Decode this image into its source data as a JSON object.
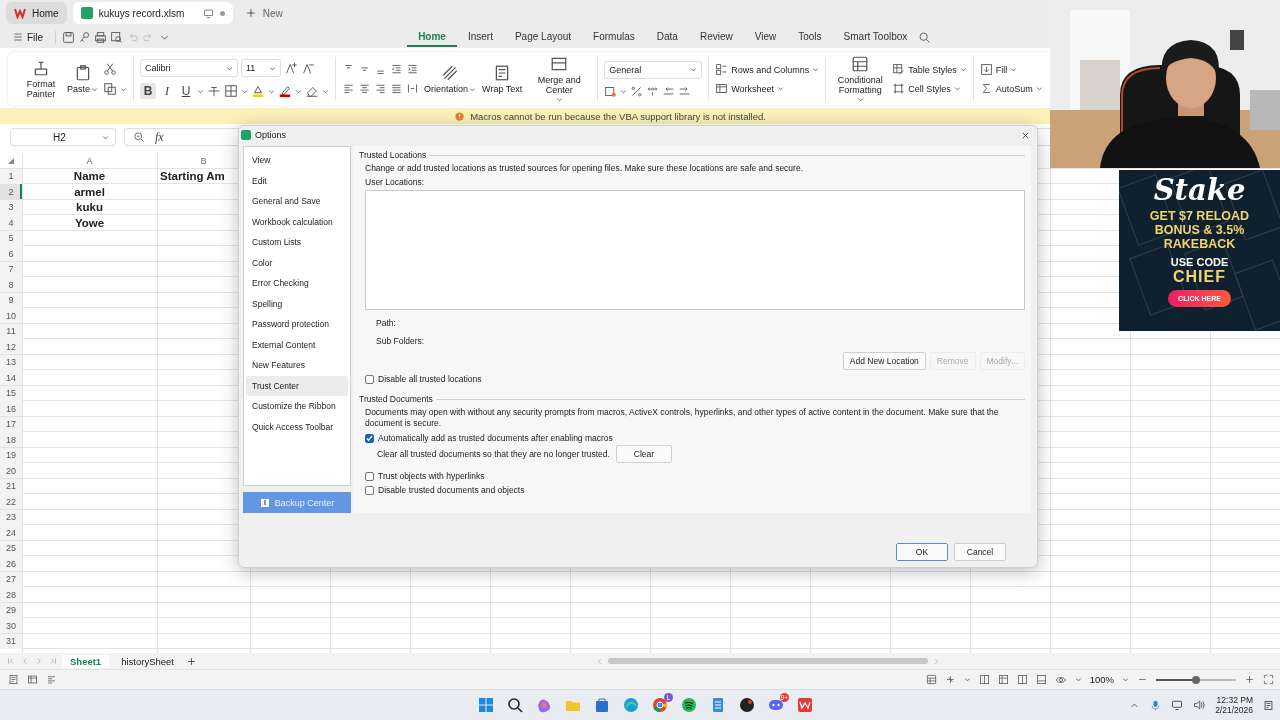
{
  "browser_tabs": [
    {
      "label": "Home",
      "selected": false
    },
    {
      "label": "kukuys record.xlsm",
      "selected": true
    }
  ],
  "new_tab": "New",
  "file_menu": "File",
  "ribbon_tabs": [
    {
      "label": "Home",
      "selected": true
    },
    {
      "label": "Insert",
      "selected": false
    },
    {
      "label": "Page Layout",
      "selected": false
    },
    {
      "label": "Formulas",
      "selected": false
    },
    {
      "label": "Data",
      "selected": false
    },
    {
      "label": "Review",
      "selected": false
    },
    {
      "label": "View",
      "selected": false
    },
    {
      "label": "Tools",
      "selected": false
    },
    {
      "label": "Smart Toolbox",
      "selected": false
    }
  ],
  "ribbon": {
    "format_painter": "Format Painter",
    "paste": "Paste",
    "font": "Calibri",
    "font_size": "11",
    "bold": {
      "label": "B",
      "on": true
    },
    "italic": {
      "label": "I",
      "on": false
    },
    "underline": {
      "label": "U",
      "on": false
    },
    "orientation": "Orientation",
    "wrap_text": "Wrap Text",
    "merge_center": "Merge and Center",
    "number_format": "General",
    "rows_columns": "Rows and Columns",
    "worksheet": "Worksheet",
    "conditional_formatting": "Conditional Formatting",
    "table_styles": "Table Styles",
    "cell_styles": "Cell Styles",
    "fill": "Fill",
    "autosum": "AutoSum"
  },
  "macro_warning": "Macros cannot be run because the VBA support library is not installed.",
  "name_box": "H2",
  "formula_label": "fx",
  "sheet": {
    "columns": [
      "A",
      "B"
    ],
    "rows": [
      {
        "number": "1",
        "selected": false,
        "cells": [
          "Name",
          "Starting Am"
        ]
      },
      {
        "number": "2",
        "selected": true,
        "cells": [
          "armel"
        ]
      },
      {
        "number": "3",
        "selected": false,
        "cells": [
          "kuku"
        ]
      },
      {
        "number": "4",
        "selected": false,
        "cells": [
          "Yowe"
        ]
      },
      {
        "number": "5",
        "selected": false
      },
      {
        "number": "6",
        "selected": false
      },
      {
        "number": "7",
        "selected": false
      },
      {
        "number": "8",
        "selected": false
      },
      {
        "number": "9",
        "selected": false
      },
      {
        "number": "10",
        "selected": false
      },
      {
        "number": "11",
        "selected": false
      },
      {
        "number": "12",
        "selected": false
      },
      {
        "number": "13",
        "selected": false
      },
      {
        "number": "14",
        "selected": false
      },
      {
        "number": "15",
        "selected": false
      },
      {
        "number": "16",
        "selected": false
      },
      {
        "number": "17",
        "selected": false
      },
      {
        "number": "18",
        "selected": false
      },
      {
        "number": "19",
        "selected": false
      },
      {
        "number": "20",
        "selected": false
      },
      {
        "number": "21",
        "selected": false
      },
      {
        "number": "22",
        "selected": false
      },
      {
        "number": "23",
        "selected": false
      },
      {
        "number": "24",
        "selected": false
      },
      {
        "number": "25",
        "selected": false
      },
      {
        "number": "26",
        "selected": false
      },
      {
        "number": "27",
        "selected": false
      },
      {
        "number": "28",
        "selected": false
      },
      {
        "number": "29",
        "selected": false
      },
      {
        "number": "30",
        "selected": false
      },
      {
        "number": "31",
        "selected": false
      }
    ]
  },
  "sheet_tabs": [
    {
      "label": "Sheet1",
      "selected": true
    },
    {
      "label": "historySheet",
      "selected": false
    }
  ],
  "zoom": "100%",
  "zoom_slider": {
    "level": 0.5
  },
  "taskbar": {
    "badges": [
      "L",
      "9+"
    ],
    "time": "12:32 PM",
    "date": "2/21/2026"
  },
  "dialog": {
    "title": "Options",
    "nav": [
      {
        "label": "View",
        "selected": false
      },
      {
        "label": "Edit",
        "selected": false
      },
      {
        "label": "General and Save",
        "selected": false
      },
      {
        "label": "Workbook calculation",
        "selected": false
      },
      {
        "label": "Custom Lists",
        "selected": false
      },
      {
        "label": "Color",
        "selected": false
      },
      {
        "label": "Error Checking",
        "selected": false
      },
      {
        "label": "Spelling",
        "selected": false
      },
      {
        "label": "Password protection",
        "selected": false
      },
      {
        "label": "External Content",
        "selected": false
      },
      {
        "label": "New Features",
        "selected": false
      },
      {
        "label": "Trust Center",
        "selected": true
      },
      {
        "label": "Customize the Ribbon",
        "selected": false
      },
      {
        "label": "Quick Access Toolbar",
        "selected": false
      }
    ],
    "backup": "Backup Center",
    "trusted_locations": {
      "heading": "Trusted Locations",
      "description": "Change or add trusted locations as trusted sources for opening files. Make sure these locations are safe and secure.",
      "list_label": "User Locations:",
      "path_label": "Path:",
      "subfolders_label": "Sub Folders:",
      "buttons": [
        {
          "label": "Add New Location",
          "disabled": false
        },
        {
          "label": "Remove",
          "disabled": true
        },
        {
          "label": "Modify...",
          "disabled": true
        }
      ],
      "disable_all": {
        "label": "Disable all trusted locations",
        "checked": false
      }
    },
    "trusted_documents": {
      "heading": "Trusted Documents",
      "description": "Documents may open with without any security prompts from macros, ActiveX controls, hyperlinks, and other types of active content in the document. Make sure that the document is secure.",
      "auto_add": {
        "label": "Automatically add as trusted documents after enabling macros",
        "checked": true
      },
      "clear_text": "Clear all trusted documents so that they are no longer trusted.",
      "clear_button": "Clear",
      "options": [
        {
          "label": "Trust objects with hyperlinks",
          "checked": false
        },
        {
          "label": "Disable trusted documents and objects",
          "checked": false
        }
      ]
    },
    "ok": "OK",
    "cancel": "Cancel"
  },
  "ad": {
    "brand": "Stake",
    "headline": "GET $7 RELOAD BONUS & 3.5% RAKEBACK",
    "code_label": "USE CODE",
    "code": "CHIEF",
    "cta": "CLICK HERE"
  }
}
